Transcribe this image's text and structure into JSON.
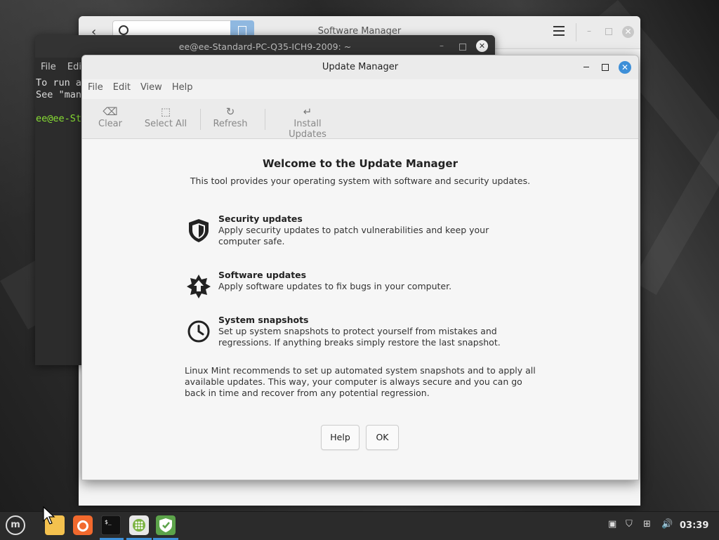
{
  "software_manager": {
    "title": "Software Manager"
  },
  "terminal": {
    "title": "ee@ee-Standard-PC-Q35-ICH9-2009: ~",
    "menu": [
      "File",
      "Edit"
    ],
    "lines": [
      "To run a",
      "See \"man"
    ],
    "prompt": "ee@ee-Sta"
  },
  "update_manager": {
    "title": "Update Manager",
    "menu": [
      "File",
      "Edit",
      "View",
      "Help"
    ],
    "toolbar": {
      "clear": "Clear",
      "select_all": "Select All",
      "refresh": "Refresh",
      "install_updates": "Install Updates"
    },
    "welcome_title": "Welcome to the Update Manager",
    "welcome_sub": "This tool provides your operating system with software and security updates.",
    "features": [
      {
        "icon": "shield-icon",
        "title": "Security updates",
        "desc": "Apply security updates to patch vulnerabilities and keep your computer safe."
      },
      {
        "icon": "star-upload-icon",
        "title": "Software updates",
        "desc": "Apply software updates to fix bugs in your computer."
      },
      {
        "icon": "clock-icon",
        "title": "System snapshots",
        "desc": "Set up system snapshots to protect yourself from mistakes and regressions. If anything breaks simply restore the last snapshot."
      }
    ],
    "recommendation": "Linux Mint recommends to set up automated system snapshots and to apply all available updates. This way, your computer is always secure and you can go back in time and recover from any potential regression.",
    "buttons": {
      "help": "Help",
      "ok": "OK"
    }
  },
  "taskbar": {
    "clock": "03:39",
    "apps": [
      "files-icon",
      "firefox-icon",
      "terminal-icon",
      "software-manager-icon",
      "update-manager-icon"
    ],
    "colors": {
      "accent": "#3d8fd8",
      "firefox": "#f2692d",
      "files": "#f4c14e",
      "mint": "#7cb342"
    }
  }
}
